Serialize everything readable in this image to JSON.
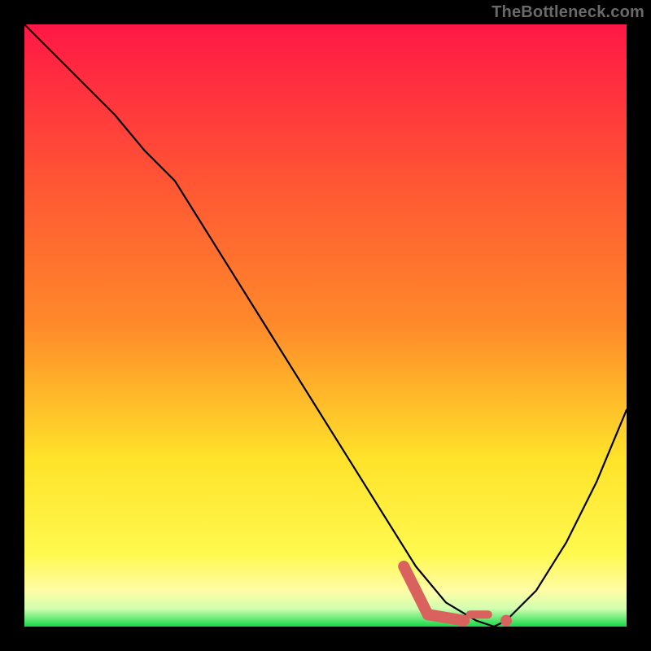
{
  "watermark": "TheBottleneck.com",
  "colors": {
    "background": "#000000",
    "watermark": "#6a6a6a",
    "curve": "#000000",
    "marker": "#d9625f",
    "gradient_top": "#ff1746",
    "gradient_mid1": "#ff8a2a",
    "gradient_mid2": "#ffe22a",
    "gradient_low": "#fffca6",
    "gradient_bottom": "#17d84a"
  },
  "chart_data": {
    "type": "line",
    "x": [
      0,
      5,
      10,
      15,
      20,
      25,
      30,
      35,
      40,
      45,
      50,
      55,
      60,
      65,
      70,
      75,
      78,
      80,
      85,
      90,
      95,
      100
    ],
    "values": [
      100,
      95,
      90,
      85,
      79,
      74,
      66,
      58,
      50,
      42,
      34,
      26,
      18,
      10,
      4,
      1,
      0,
      1,
      6,
      14,
      24,
      36
    ],
    "title": "",
    "xlabel": "",
    "ylabel": "",
    "xlim": [
      0,
      100
    ],
    "ylim": [
      0,
      100
    ],
    "markers": {
      "segment": {
        "x0": 63,
        "y0": 10,
        "x1": 67,
        "y1": 2
      },
      "flat": {
        "x0": 67,
        "y0": 2,
        "x1": 73,
        "y1": 1
      },
      "dot": {
        "x": 80,
        "y": 1
      },
      "tail": {
        "x0": 74,
        "y0": 2,
        "x1": 77,
        "y1": 2
      }
    }
  }
}
